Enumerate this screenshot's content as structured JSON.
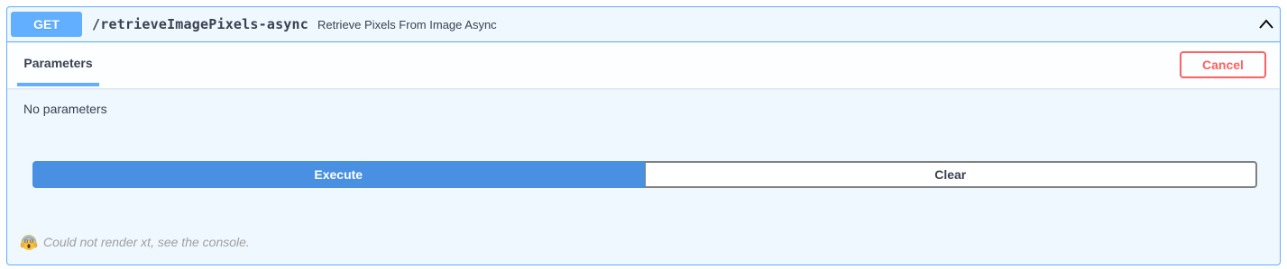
{
  "operation": {
    "method": "GET",
    "path": "/retrieveImagePixels-async",
    "description": "Retrieve Pixels From Image Async",
    "expanded_icon": "chevron-up-icon"
  },
  "parameters_section": {
    "tab_label": "Parameters",
    "cancel_label": "Cancel",
    "empty_text": "No parameters"
  },
  "actions": {
    "execute_label": "Execute",
    "clear_label": "Clear"
  },
  "error": {
    "icon": "screaming-face-icon",
    "message": "Could not render xt, see the console."
  },
  "colors": {
    "get_accent": "#61affe",
    "block_background": "#eff7ff",
    "execute": "#4990e2",
    "cancel": "#ff6060",
    "text": "#3b4151",
    "error_text": "#a0a0a0"
  }
}
